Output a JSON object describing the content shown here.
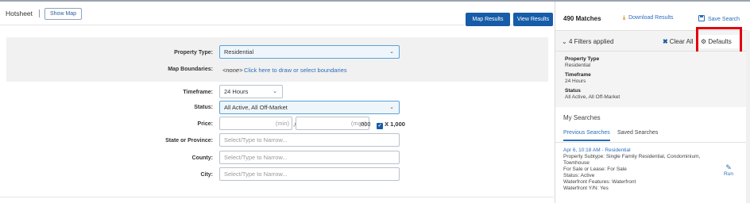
{
  "toolbar": {
    "title": "Hotsheet",
    "show_map": "Show Map",
    "map_results": "Map Results",
    "view_results": "View Results"
  },
  "form": {
    "property_type": {
      "label": "Property Type:",
      "value": "Residential"
    },
    "map_boundaries": {
      "label": "Map Boundaries:",
      "value": "<none>",
      "link": "Click here to draw or select boundaries"
    },
    "timeframe": {
      "label": "Timeframe:",
      "value": "24 Hours"
    },
    "status": {
      "label": "Status:",
      "value": "All Active, All Off-Market"
    },
    "price": {
      "label": "Price:",
      "min_placeholder": "(min)",
      "max_placeholder": "(max)",
      "suffix": ",000",
      "multiplier": "X 1,000",
      "multiplier_checked": true
    },
    "state": {
      "label": "State or Province:",
      "placeholder": "Select/Type to Narrow..."
    },
    "county": {
      "label": "County:",
      "placeholder": "Select/Type to Narrow..."
    },
    "city": {
      "label": "City:",
      "placeholder": "Select/Type to Narrow..."
    }
  },
  "results": {
    "matches": "490 Matches",
    "download": "Download Results",
    "save_search": "Save Search"
  },
  "filters": {
    "summary": "4 Filters applied",
    "clear_all": "Clear All",
    "defaults": "Defaults",
    "items": [
      {
        "title": "Property Type",
        "value": "Residential"
      },
      {
        "title": "Timeframe",
        "value": "24 Hours"
      },
      {
        "title": "Status",
        "value": "All Active, All Off-Market"
      }
    ]
  },
  "my_searches": {
    "heading": "My Searches",
    "tabs": [
      "Previous Searches",
      "Saved Searches"
    ],
    "active_tab": 0,
    "entry": {
      "title": "Apr 6, 10:18 AM - Residential",
      "lines": [
        "Property Subtype: Single Family Residential, Condominium,",
        "Townhouse",
        "For Sale or Lease: For Sale",
        "Status: Active",
        "Waterfront Features: Waterfront",
        "Waterfront Y/N: Yes"
      ],
      "run_label": "Run"
    }
  },
  "colors": {
    "primary_blue": "#175ca8",
    "link_blue": "#2a6ebb",
    "highlight_red": "#e3000f",
    "download_orange": "#e08a14"
  },
  "icons": {
    "download": "download-icon",
    "save": "save-icon",
    "clear": "close-icon",
    "defaults": "gear-icon",
    "collapse": "chevron-down-icon",
    "run": "wrench-icon"
  }
}
